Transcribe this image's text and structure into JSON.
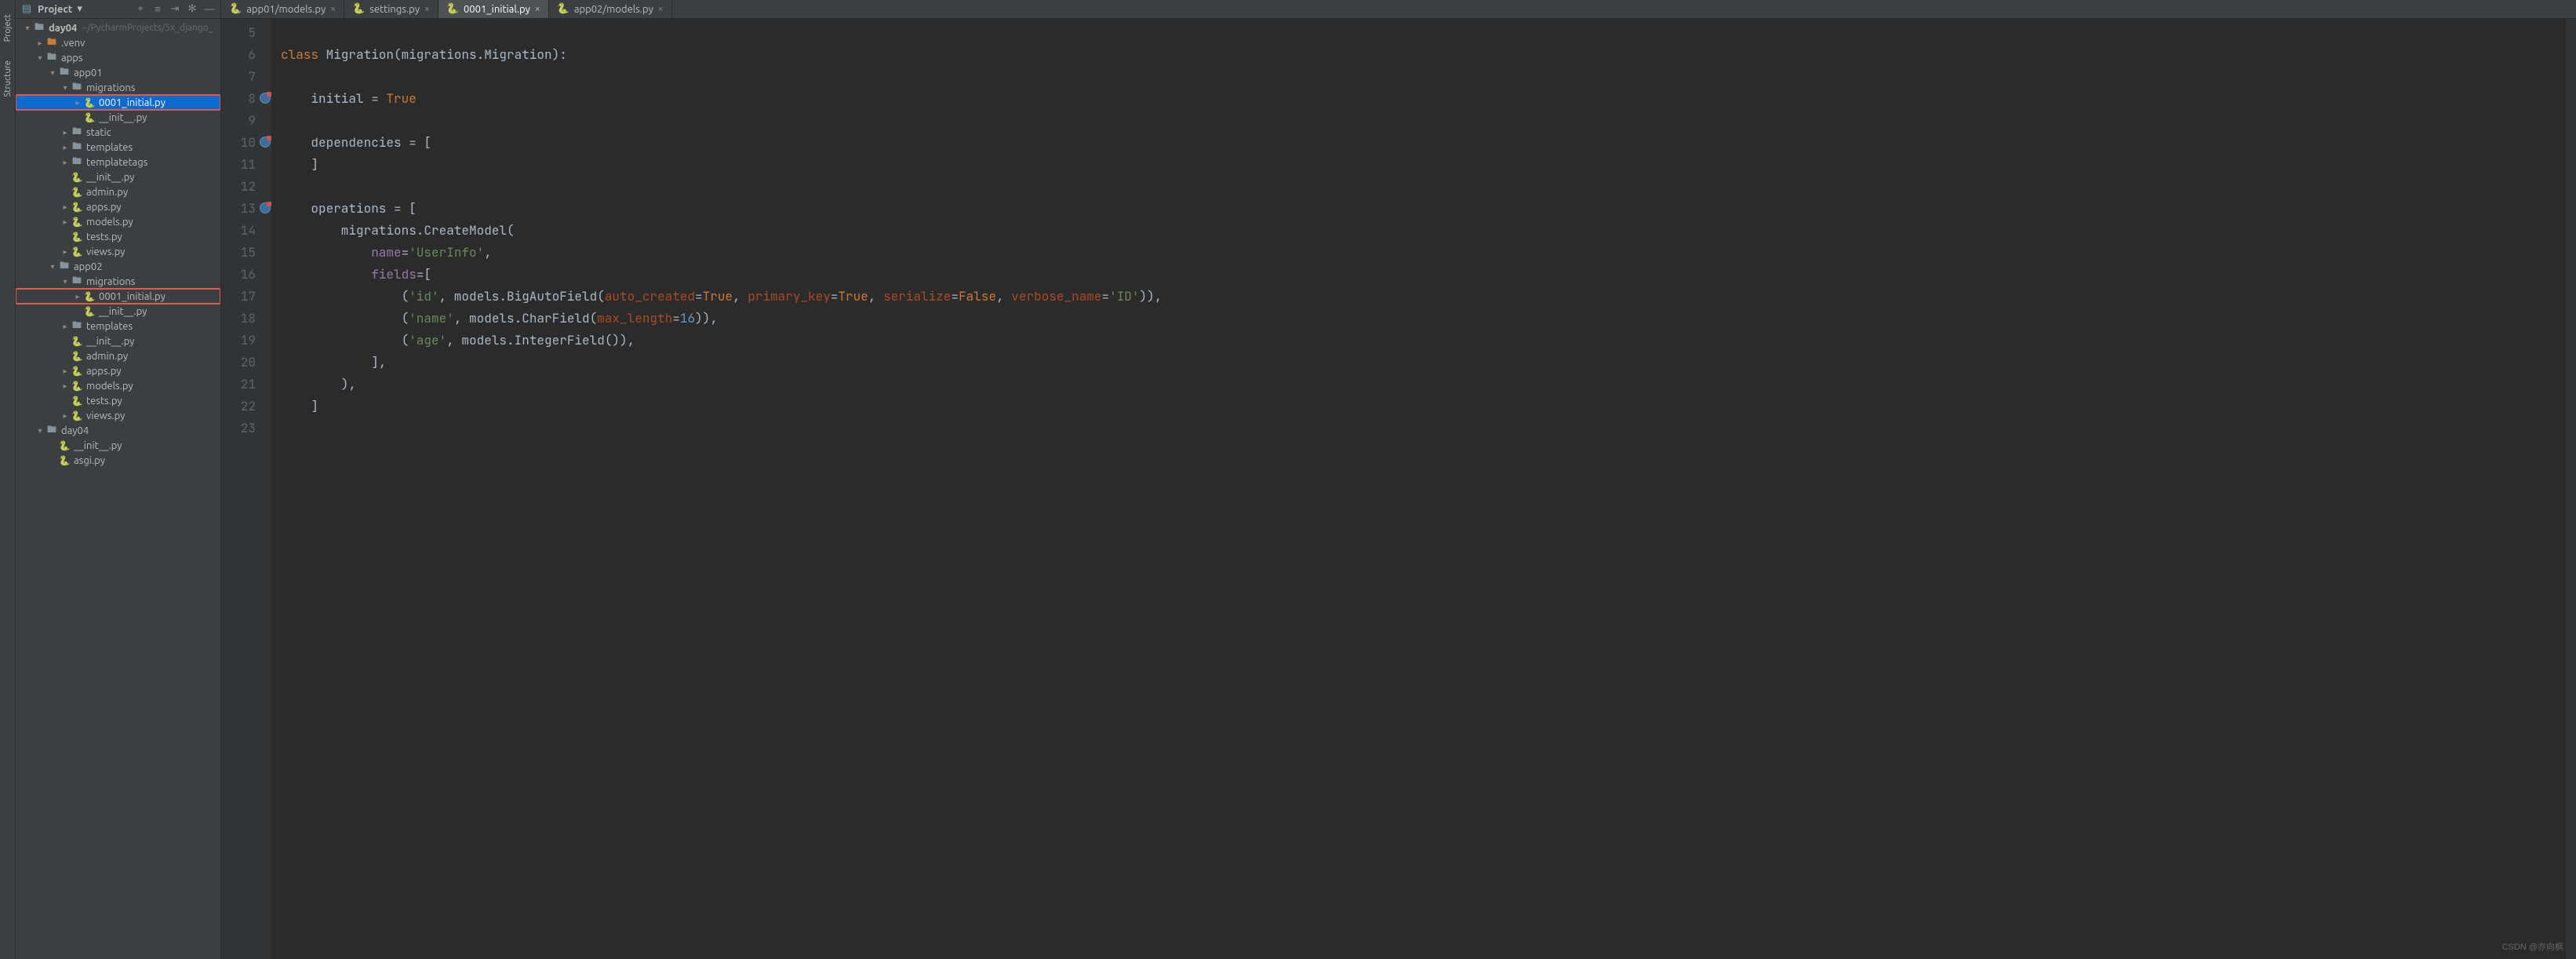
{
  "toolstrip": {
    "labels": [
      "Project",
      "Structure"
    ]
  },
  "project_header": {
    "title": "Project",
    "dropdown_glyph": "▾"
  },
  "tree": [
    {
      "depth": 0,
      "expand": "down",
      "icon": "folder",
      "iconCls": "ic-folder",
      "label": "day04",
      "extra": "~/PycharmProjects/5x_django_",
      "sel": false,
      "box": false,
      "bold": true
    },
    {
      "depth": 1,
      "expand": "right",
      "icon": "folder",
      "iconCls": "ic-folder-orange",
      "label": ".venv",
      "extra": "",
      "sel": false,
      "box": false
    },
    {
      "depth": 1,
      "expand": "down",
      "icon": "folder",
      "iconCls": "ic-folder",
      "label": "apps",
      "extra": "",
      "sel": false,
      "box": false
    },
    {
      "depth": 2,
      "expand": "down",
      "icon": "folder",
      "iconCls": "ic-folder",
      "label": "app01",
      "extra": "",
      "sel": false,
      "box": false
    },
    {
      "depth": 3,
      "expand": "down",
      "icon": "folder",
      "iconCls": "ic-folder",
      "label": "migrations",
      "extra": "",
      "sel": false,
      "box": false
    },
    {
      "depth": 4,
      "expand": "right",
      "icon": "py",
      "iconCls": "ic-py",
      "label": "0001_initial.py",
      "extra": "",
      "sel": true,
      "box": true
    },
    {
      "depth": 4,
      "expand": "none",
      "icon": "py",
      "iconCls": "ic-py",
      "label": "__init__.py",
      "extra": "",
      "sel": false,
      "box": false
    },
    {
      "depth": 3,
      "expand": "right",
      "icon": "folder",
      "iconCls": "ic-folder",
      "label": "static",
      "extra": "",
      "sel": false,
      "box": false
    },
    {
      "depth": 3,
      "expand": "right",
      "icon": "folder",
      "iconCls": "ic-folder",
      "label": "templates",
      "extra": "",
      "sel": false,
      "box": false
    },
    {
      "depth": 3,
      "expand": "right",
      "icon": "folder",
      "iconCls": "ic-folder",
      "label": "templatetags",
      "extra": "",
      "sel": false,
      "box": false
    },
    {
      "depth": 3,
      "expand": "none",
      "icon": "py",
      "iconCls": "ic-py",
      "label": "__init__.py",
      "extra": "",
      "sel": false,
      "box": false
    },
    {
      "depth": 3,
      "expand": "none",
      "icon": "py",
      "iconCls": "ic-py",
      "label": "admin.py",
      "extra": "",
      "sel": false,
      "box": false
    },
    {
      "depth": 3,
      "expand": "right",
      "icon": "py",
      "iconCls": "ic-py",
      "label": "apps.py",
      "extra": "",
      "sel": false,
      "box": false
    },
    {
      "depth": 3,
      "expand": "right",
      "icon": "py",
      "iconCls": "ic-py",
      "label": "models.py",
      "extra": "",
      "sel": false,
      "box": false
    },
    {
      "depth": 3,
      "expand": "none",
      "icon": "py",
      "iconCls": "ic-py",
      "label": "tests.py",
      "extra": "",
      "sel": false,
      "box": false
    },
    {
      "depth": 3,
      "expand": "right",
      "icon": "py",
      "iconCls": "ic-py",
      "label": "views.py",
      "extra": "",
      "sel": false,
      "box": false
    },
    {
      "depth": 2,
      "expand": "down",
      "icon": "folder",
      "iconCls": "ic-folder",
      "label": "app02",
      "extra": "",
      "sel": false,
      "box": false
    },
    {
      "depth": 3,
      "expand": "down",
      "icon": "folder",
      "iconCls": "ic-folder",
      "label": "migrations",
      "extra": "",
      "sel": false,
      "box": false
    },
    {
      "depth": 4,
      "expand": "right",
      "icon": "py",
      "iconCls": "ic-py",
      "label": "0001_initial.py",
      "extra": "",
      "sel": false,
      "box": true
    },
    {
      "depth": 4,
      "expand": "none",
      "icon": "py",
      "iconCls": "ic-py",
      "label": "__init__.py",
      "extra": "",
      "sel": false,
      "box": false
    },
    {
      "depth": 3,
      "expand": "right",
      "icon": "folder",
      "iconCls": "ic-folder",
      "label": "templates",
      "extra": "",
      "sel": false,
      "box": false
    },
    {
      "depth": 3,
      "expand": "none",
      "icon": "py",
      "iconCls": "ic-py",
      "label": "__init__.py",
      "extra": "",
      "sel": false,
      "box": false
    },
    {
      "depth": 3,
      "expand": "none",
      "icon": "py",
      "iconCls": "ic-py",
      "label": "admin.py",
      "extra": "",
      "sel": false,
      "box": false
    },
    {
      "depth": 3,
      "expand": "right",
      "icon": "py",
      "iconCls": "ic-py",
      "label": "apps.py",
      "extra": "",
      "sel": false,
      "box": false
    },
    {
      "depth": 3,
      "expand": "right",
      "icon": "py",
      "iconCls": "ic-py",
      "label": "models.py",
      "extra": "",
      "sel": false,
      "box": false
    },
    {
      "depth": 3,
      "expand": "none",
      "icon": "py",
      "iconCls": "ic-py",
      "label": "tests.py",
      "extra": "",
      "sel": false,
      "box": false
    },
    {
      "depth": 3,
      "expand": "right",
      "icon": "py",
      "iconCls": "ic-py",
      "label": "views.py",
      "extra": "",
      "sel": false,
      "box": false
    },
    {
      "depth": 1,
      "expand": "down",
      "icon": "folder",
      "iconCls": "ic-folder",
      "label": "day04",
      "extra": "",
      "sel": false,
      "box": false
    },
    {
      "depth": 2,
      "expand": "none",
      "icon": "py",
      "iconCls": "ic-py",
      "label": "__init__.py",
      "extra": "",
      "sel": false,
      "box": false
    },
    {
      "depth": 2,
      "expand": "none",
      "icon": "py",
      "iconCls": "ic-py",
      "label": "asgi.py",
      "extra": "",
      "sel": false,
      "box": false
    }
  ],
  "tabs": [
    {
      "label": "app01/models.py",
      "active": false
    },
    {
      "label": "settings.py",
      "active": false
    },
    {
      "label": "0001_initial.py",
      "active": true
    },
    {
      "label": "app02/models.py",
      "active": false
    }
  ],
  "gutter": {
    "start": 5,
    "count": 19,
    "marks": [
      8,
      10,
      13
    ]
  },
  "code_lines": [
    [
      {
        "t": "",
        "c": ""
      }
    ],
    [
      {
        "t": "class ",
        "c": "kw"
      },
      {
        "t": "Migration(migrations.Migration):",
        "c": "def"
      }
    ],
    [
      {
        "t": "",
        "c": ""
      }
    ],
    [
      {
        "t": "    initial = ",
        "c": "def"
      },
      {
        "t": "True",
        "c": "kw"
      }
    ],
    [
      {
        "t": "",
        "c": ""
      }
    ],
    [
      {
        "t": "    dependencies = [",
        "c": "def"
      }
    ],
    [
      {
        "t": "    ]",
        "c": "def"
      }
    ],
    [
      {
        "t": "",
        "c": ""
      }
    ],
    [
      {
        "t": "    operations = [",
        "c": "def"
      }
    ],
    [
      {
        "t": "        migrations.CreateModel(",
        "c": "def"
      }
    ],
    [
      {
        "t": "            ",
        "c": "def"
      },
      {
        "t": "name",
        "c": "fld"
      },
      {
        "t": "=",
        "c": "def"
      },
      {
        "t": "'UserInfo'",
        "c": "str"
      },
      {
        "t": ",",
        "c": "def"
      }
    ],
    [
      {
        "t": "            ",
        "c": "def"
      },
      {
        "t": "fields",
        "c": "fld"
      },
      {
        "t": "=[",
        "c": "def"
      }
    ],
    [
      {
        "t": "                (",
        "c": "def"
      },
      {
        "t": "'id'",
        "c": "str"
      },
      {
        "t": ", models.BigAutoField(",
        "c": "def"
      },
      {
        "t": "auto_created",
        "c": "par"
      },
      {
        "t": "=",
        "c": "def"
      },
      {
        "t": "True",
        "c": "kw"
      },
      {
        "t": ", ",
        "c": "def"
      },
      {
        "t": "primary_key",
        "c": "par"
      },
      {
        "t": "=",
        "c": "def"
      },
      {
        "t": "True",
        "c": "kw"
      },
      {
        "t": ", ",
        "c": "def"
      },
      {
        "t": "serialize",
        "c": "par"
      },
      {
        "t": "=",
        "c": "def"
      },
      {
        "t": "False",
        "c": "kw"
      },
      {
        "t": ", ",
        "c": "def"
      },
      {
        "t": "verbose_name",
        "c": "par"
      },
      {
        "t": "=",
        "c": "def"
      },
      {
        "t": "'ID'",
        "c": "str"
      },
      {
        "t": ")),",
        "c": "def"
      }
    ],
    [
      {
        "t": "                (",
        "c": "def"
      },
      {
        "t": "'name'",
        "c": "str"
      },
      {
        "t": ", models.CharField(",
        "c": "def"
      },
      {
        "t": "max_length",
        "c": "par"
      },
      {
        "t": "=",
        "c": "def"
      },
      {
        "t": "16",
        "c": "num"
      },
      {
        "t": ")),",
        "c": "def"
      }
    ],
    [
      {
        "t": "                (",
        "c": "def"
      },
      {
        "t": "'age'",
        "c": "str"
      },
      {
        "t": ", models.IntegerField()),",
        "c": "def"
      }
    ],
    [
      {
        "t": "            ],",
        "c": "def"
      }
    ],
    [
      {
        "t": "        ),",
        "c": "def"
      }
    ],
    [
      {
        "t": "    ]",
        "c": "def"
      }
    ],
    [
      {
        "t": "",
        "c": ""
      }
    ]
  ],
  "watermark": "CSDN @亦向枫"
}
